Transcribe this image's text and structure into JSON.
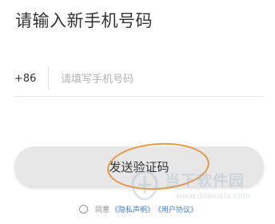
{
  "header": {
    "title": "请输入新手机号码"
  },
  "phone": {
    "country_code": "+86",
    "placeholder": "请填写手机号码"
  },
  "actions": {
    "send_code_label": "发送验证码"
  },
  "agreement": {
    "prefix": "同意",
    "privacy_link": "《隐私声明》",
    "user_link": "《用户协议》"
  },
  "watermark": {
    "brand": "当下软件园",
    "url": "www.downxia.com"
  },
  "colors": {
    "link": "#3c7dcf",
    "highlight_ring": "#e29a44",
    "button_bg": "#e7e7e7"
  }
}
